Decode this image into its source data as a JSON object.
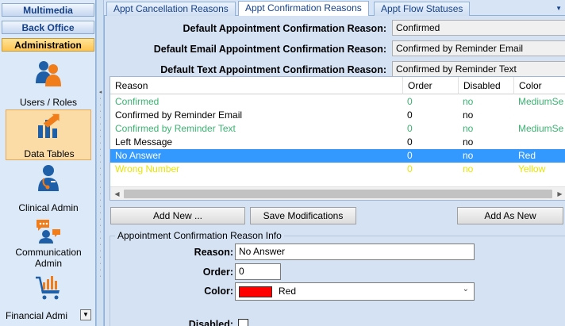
{
  "nav": {
    "headers": [
      {
        "label": "Multimedia"
      },
      {
        "label": "Back Office"
      },
      {
        "label": "Administration"
      }
    ],
    "tiles": [
      {
        "label": "Users / Roles",
        "icon": "users-icon"
      },
      {
        "label": "Data Tables",
        "icon": "data-tables-icon",
        "selected": true
      },
      {
        "label": "Clinical Admin",
        "icon": "clinician-icon"
      },
      {
        "label": "Communication\nAdmin",
        "icon": "communication-icon"
      },
      {
        "label": "Financial Admi",
        "icon": "cart-chart-icon"
      }
    ],
    "scroll_icon": "triangle-down-icon"
  },
  "tabs": [
    {
      "label": "Appt Cancellation Reasons"
    },
    {
      "label": "Appt Confirmation Reasons",
      "active": true
    },
    {
      "label": "Appt Flow Statuses"
    }
  ],
  "tab_menu_icon": "triangle-down-icon",
  "defaults": [
    {
      "label": "Default Appointment Confirmation Reason:",
      "value": "Confirmed"
    },
    {
      "label": "Default Email Appointment Confirmation Reason:",
      "value": "Confirmed by Reminder Email"
    },
    {
      "label": "Default Text Appointment Confirmation Reason:",
      "value": "Confirmed by Reminder Text"
    }
  ],
  "grid": {
    "columns": [
      "Reason",
      "Order",
      "Disabled",
      "Color"
    ],
    "rows": [
      {
        "reason": "Confirmed",
        "order": "0",
        "disabled": "no",
        "color": "MediumSe",
        "text_color": "#3cb371"
      },
      {
        "reason": "Confirmed by Reminder Email",
        "order": "0",
        "disabled": "no",
        "color": "",
        "text_color": "#000000"
      },
      {
        "reason": "Confirmed by Reminder Text",
        "order": "0",
        "disabled": "no",
        "color": "MediumSe",
        "text_color": "#3cb371"
      },
      {
        "reason": "Left Message",
        "order": "0",
        "disabled": "no",
        "color": "",
        "text_color": "#000000"
      },
      {
        "reason": "No Answer",
        "order": "0",
        "disabled": "no",
        "color": "Red",
        "text_color": "#ff0000",
        "selected": true
      },
      {
        "reason": "Wrong Number",
        "order": "0",
        "disabled": "no",
        "color": "Yellow",
        "text_color": "#e6e600"
      }
    ]
  },
  "buttons": {
    "add_new": "Add New ...",
    "save": "Save Modifications",
    "add_as_new": "Add As New"
  },
  "info": {
    "legend": "Appointment Confirmation Reason Info",
    "reason_label": "Reason:",
    "reason_value": "No Answer",
    "order_label": "Order:",
    "order_value": "0",
    "color_label": "Color:",
    "color_value": "Red",
    "color_swatch": "#ff0000",
    "disabled_label": "Disabled:",
    "disabled_checked": false
  },
  "colors": {
    "selection": "#3399ff",
    "accent_orange": "#ffc44f",
    "nav_header_text": "#15428b"
  }
}
